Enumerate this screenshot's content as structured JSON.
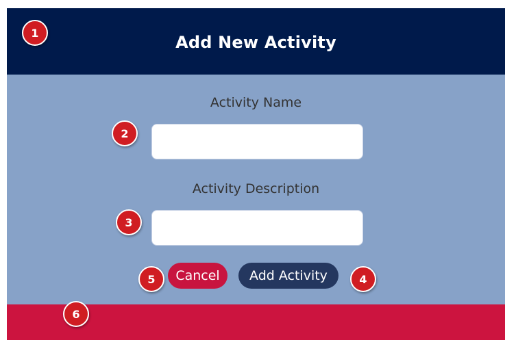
{
  "header": {
    "title": "Add New Activity"
  },
  "form": {
    "name_label": "Activity Name",
    "name_value": "",
    "description_label": "Activity Description",
    "description_value": "",
    "cancel_label": "Cancel",
    "submit_label": "Add Activity"
  },
  "markers": [
    "1",
    "2",
    "3",
    "4",
    "5",
    "6"
  ],
  "colors": {
    "header_bg": "#001a4b",
    "form_bg": "#87a2c8",
    "cancel_bg": "#c8143f",
    "submit_bg": "#24375f",
    "footer_bg": "#cc143f",
    "marker_bg": "#d01d22"
  }
}
